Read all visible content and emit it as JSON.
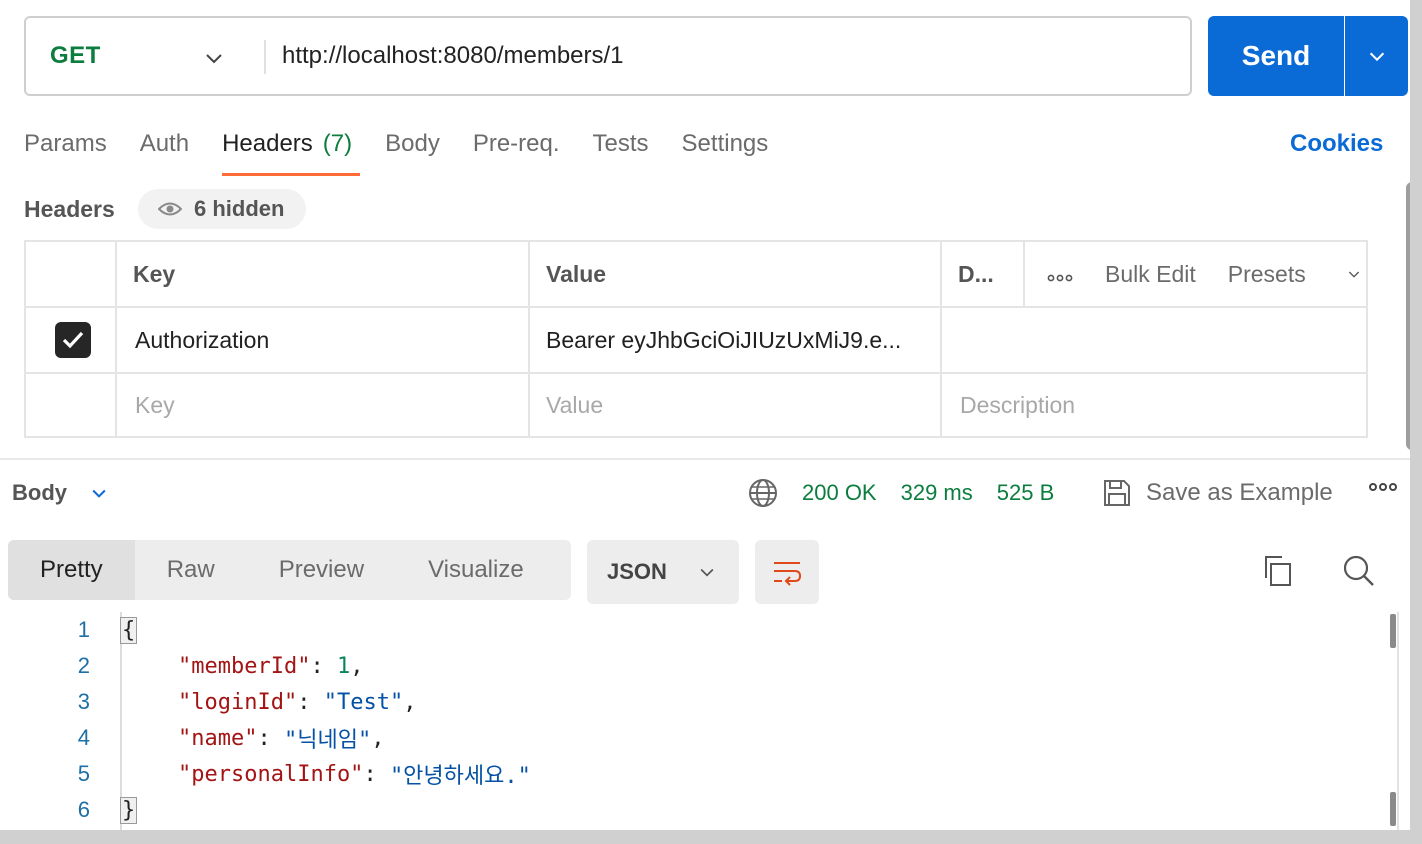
{
  "request": {
    "method": "GET",
    "url": "http://localhost:8080/members/1",
    "send_label": "Send"
  },
  "tabs": [
    {
      "label": "Params"
    },
    {
      "label": "Auth"
    },
    {
      "label": "Headers",
      "count": "(7)"
    },
    {
      "label": "Body"
    },
    {
      "label": "Pre-req."
    },
    {
      "label": "Tests"
    },
    {
      "label": "Settings"
    }
  ],
  "cookies_label": "Cookies",
  "headers_section": {
    "title": "Headers",
    "hidden_label": "6 hidden",
    "columns": {
      "key": "Key",
      "value": "Value",
      "description": "D..."
    },
    "tools": {
      "bulk_edit": "Bulk Edit",
      "presets": "Presets"
    },
    "rows": [
      {
        "checked": true,
        "key": "Authorization",
        "value": "Bearer eyJhbGciOiJIUzUxMiJ9.e..."
      }
    ],
    "placeholders": {
      "key": "Key",
      "value": "Value",
      "description": "Description"
    }
  },
  "response": {
    "body_label": "Body",
    "status": "200 OK",
    "time": "329 ms",
    "size": "525 B",
    "save_label": "Save as Example",
    "modes": [
      "Pretty",
      "Raw",
      "Preview",
      "Visualize"
    ],
    "format": "JSON",
    "lines": [
      "1",
      "2",
      "3",
      "4",
      "5",
      "6"
    ],
    "json": {
      "k1": "\"memberId\"",
      "v1": "1",
      "k2": "\"loginId\"",
      "v2": "\"Test\"",
      "k3": "\"name\"",
      "v3": "\"닉네임\"",
      "k4": "\"personalInfo\"",
      "v4": "\"안녕하세요.\""
    }
  },
  "colors": {
    "accent": "#ff6c37",
    "send": "#0b6bd6",
    "ok": "#0b7d3e"
  }
}
